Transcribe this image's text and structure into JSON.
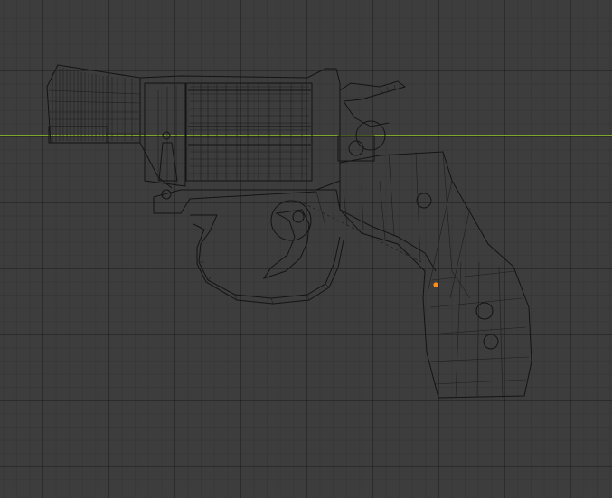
{
  "viewport": {
    "background_color": "#3d3d3d",
    "grid_color": "#333333",
    "x_axis_color": "#7fa52a",
    "z_axis_color": "#4b7bd0",
    "wire_color": "#141414",
    "selected_vertex_color": "#ff8c1a"
  },
  "scene": {
    "object_icon": "revolver-wireframe-mesh",
    "display_mode": "wireframe"
  }
}
